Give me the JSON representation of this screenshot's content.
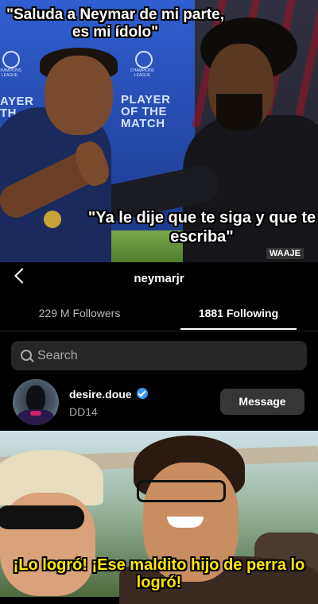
{
  "top_panel": {
    "caption_top": "\"Saluda a Neymar de mi parte, es mi ídolo\"",
    "caption_middle": "\"Ya le dije que te siga y que te escriba\"",
    "banner_text_left": "AYER\nTH   H",
    "banner_text_right": "PLAYER\nOF THE\nMATCH",
    "logo_caption": "CHAMPIONS\nLEAGUE",
    "watermark": "WAAJE"
  },
  "instagram": {
    "profile_name": "neymarjr",
    "tabs": [
      {
        "label": "229 M Followers",
        "active": false
      },
      {
        "label": "1881 Following",
        "active": true
      }
    ],
    "search_placeholder": "Search",
    "list": [
      {
        "username": "desire.doue",
        "verified": true,
        "full_name": "DD14",
        "button_label": "Message"
      }
    ],
    "colors": {
      "background": "#000000",
      "search_bg": "#262626",
      "button_bg": "#363636",
      "verified": "#3897f0"
    }
  },
  "bottom_panel": {
    "caption": "¡Lo logró! ¡Ese maldito hijo de perra lo logró!",
    "caption_color": "#ffe600"
  }
}
